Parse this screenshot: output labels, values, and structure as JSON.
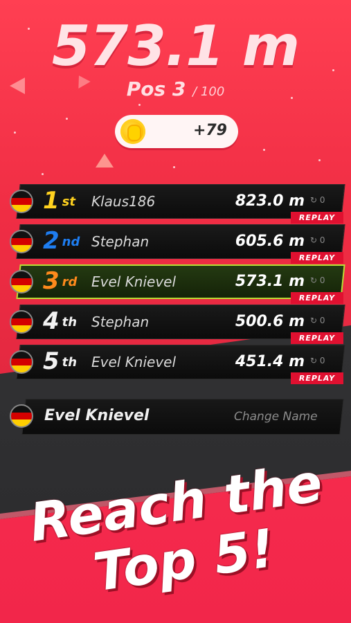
{
  "header": {
    "distance": "573.1 m",
    "position_label": "Pos 3",
    "position_total": "/ 100"
  },
  "coins": {
    "amount": "+79",
    "icon": "coin-icon"
  },
  "leaderboard": [
    {
      "rank": "1",
      "suffix": "st",
      "name": "Klaus186",
      "distance": "823.0 m",
      "meta": "↻ 0",
      "replay": "REPLAY",
      "rank_color": "#ffd21f",
      "highlight": false
    },
    {
      "rank": "2",
      "suffix": "nd",
      "name": "Stephan",
      "distance": "605.6 m",
      "meta": "↻ 0",
      "replay": "REPLAY",
      "rank_color": "#1e7df0",
      "highlight": false
    },
    {
      "rank": "3",
      "suffix": "rd",
      "name": "Evel Knievel",
      "distance": "573.1 m",
      "meta": "↻ 0",
      "replay": "REPLAY",
      "rank_color": "#ff8a1c",
      "highlight": true
    },
    {
      "rank": "4",
      "suffix": "th",
      "name": "Stephan",
      "distance": "500.6 m",
      "meta": "↻ 0",
      "replay": "REPLAY",
      "rank_color": "#f2f2f2",
      "highlight": false
    },
    {
      "rank": "5",
      "suffix": "th",
      "name": "Evel Knievel",
      "distance": "451.4 m",
      "meta": "↻ 0",
      "replay": "REPLAY",
      "rank_color": "#f2f2f2",
      "highlight": false
    }
  ],
  "player": {
    "name": "Evel Knievel",
    "change_name": "Change Name"
  },
  "banner": {
    "line1": "Reach the",
    "line2": "Top 5!"
  },
  "colors": {
    "background": "#f2364a",
    "replay": "#e01030",
    "highlight_border": "#b6e034"
  }
}
